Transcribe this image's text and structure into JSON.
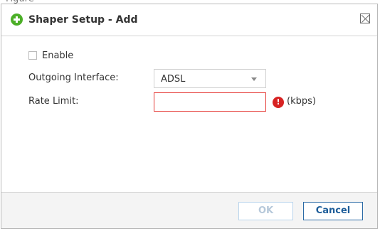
{
  "dialog": {
    "title": "Shaper Setup - Add",
    "header_icon": "plus-circle-icon",
    "close_icon": "close-icon"
  },
  "form": {
    "enable_label": "Enable",
    "enable_checked": false,
    "outgoing_interface_label": "Outgoing Interface:",
    "outgoing_interface_value": "ADSL",
    "rate_limit_label": "Rate Limit:",
    "rate_limit_value": "",
    "rate_limit_unit": "(kbps)",
    "rate_limit_error_icon": "exclamation-circle-icon"
  },
  "buttons": {
    "ok_label": "OK",
    "cancel_label": "Cancel"
  },
  "colors": {
    "accent_green": "#4caf28",
    "error_red": "#d72222",
    "primary_blue": "#1d5d99"
  }
}
